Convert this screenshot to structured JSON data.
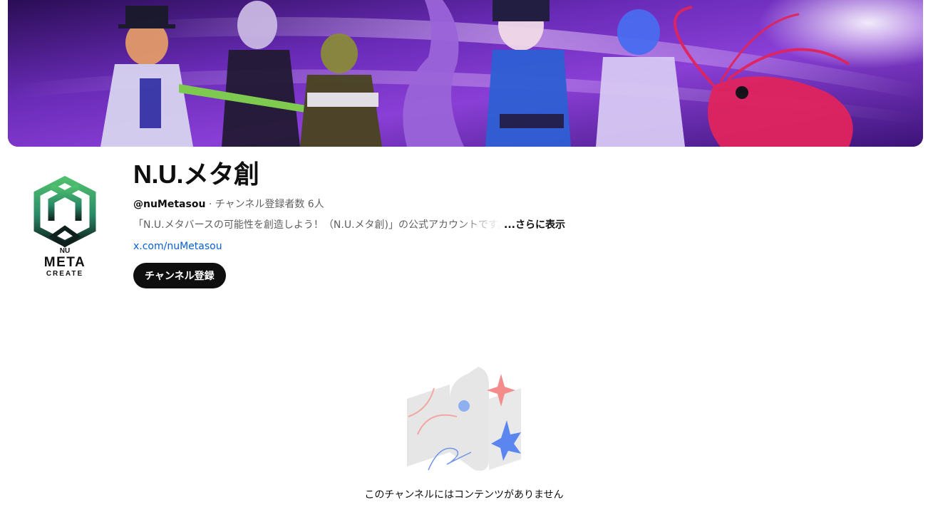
{
  "channel": {
    "title": "N.U.メタ創",
    "handle": "@nuMetasou",
    "separator": " · ",
    "subscribers": "チャンネル登録者数 6人",
    "description": "「N.U.メタバースの可能性を創造しよう！（N.U.メタ創)」の公式アカウントです。",
    "more_label": "...さらに表示",
    "link": "x.com/nuMetasou",
    "subscribe_label": "チャンネル登録"
  },
  "avatar": {
    "logo_line1": "NU",
    "logo_line2": "META",
    "logo_line3": "CREATE"
  },
  "empty_state": {
    "message": "このチャンネルにはコンテンツがありません"
  },
  "colors": {
    "banner_purple": "#5b1fa8",
    "link_blue": "#065fd4",
    "button_black": "#0f0f0f",
    "logo_green": "#3fa36a",
    "logo_teal": "#1f6b5c"
  }
}
